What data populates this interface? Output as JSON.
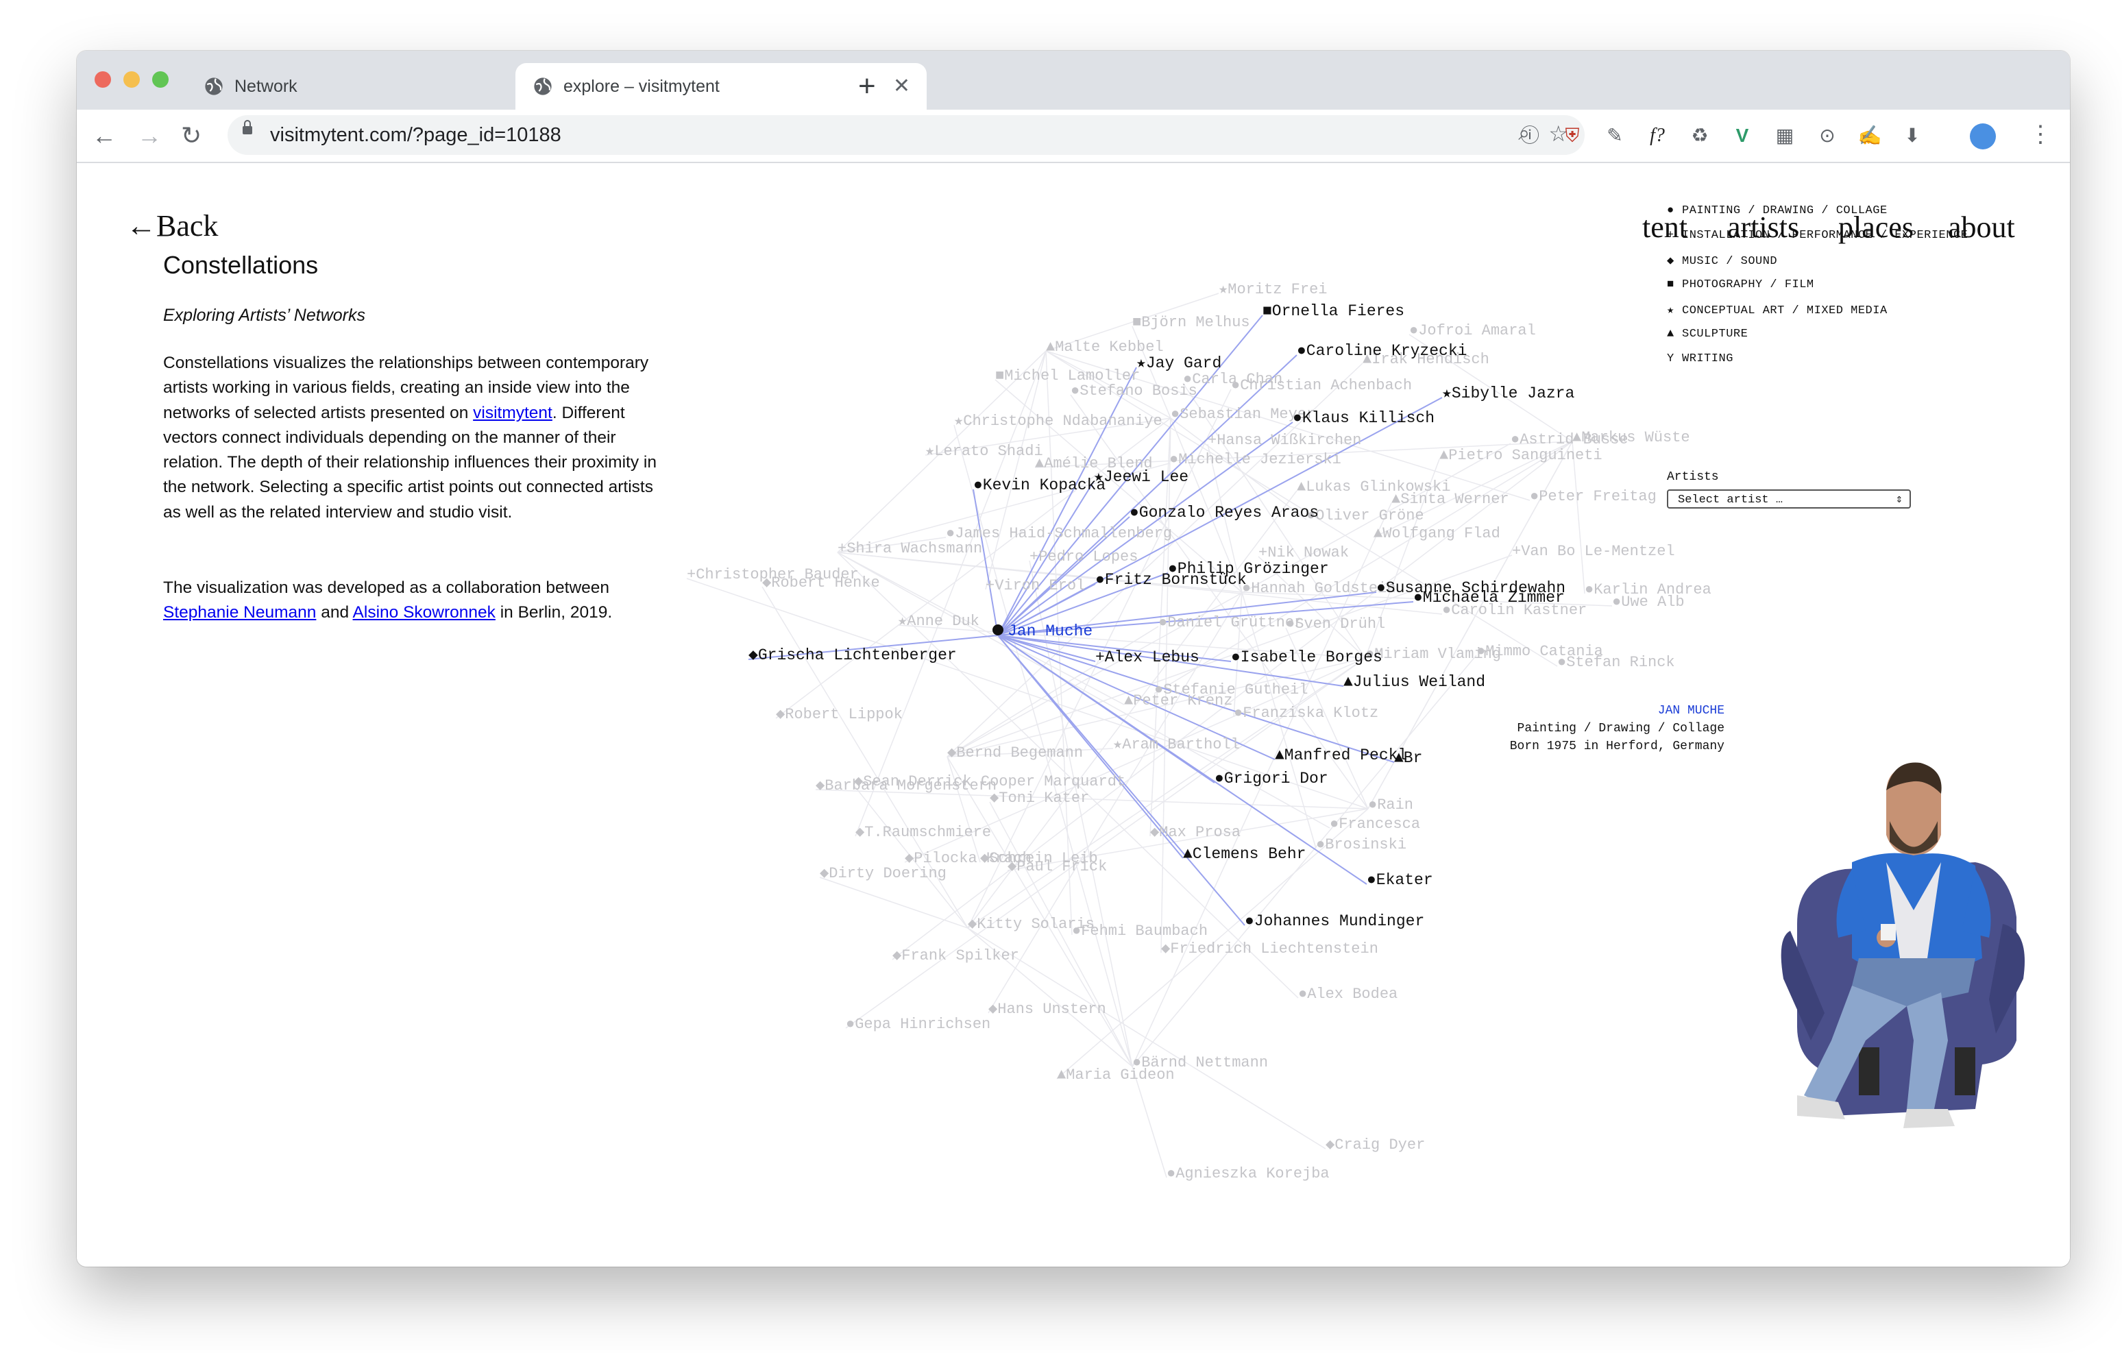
{
  "browser": {
    "tabs": [
      {
        "title": "Network",
        "active": false
      },
      {
        "title": "explore – visitmytent",
        "active": true
      }
    ],
    "url": "visitmytent.com/?page_id=10188"
  },
  "nav": {
    "back": "Back",
    "links": [
      "tent",
      "artists",
      "places",
      "about"
    ]
  },
  "intro": {
    "title": "Constellations",
    "subtitle": "Exploring Artists’ Networks",
    "p1_a": "Constellations visualizes the relationships between contemporary artists working in various fields, creating an inside view into the networks of selected artists presented on ",
    "p1_link": "visitmytent",
    "p1_b": ". Different vectors connect individuals depending on the manner of their relation. The depth of their relationship influences their proximity in the network. Selecting a specific artist points out connected artists as well as the related interview and studio visit.",
    "p2_a": "The visualization was developed as a collaboration between ",
    "p2_link1": "Stephanie Neumann",
    "p2_and": " and ",
    "p2_link2": "Alsino Skowronnek",
    "p2_b": " in Berlin, 2019."
  },
  "legend": [
    {
      "symbol": "dot",
      "label": "PAINTING / DRAWING / COLLAGE"
    },
    {
      "symbol": "cross",
      "label": "INSTALLATION / PERFORMANCE / EXPERIENCE"
    },
    {
      "symbol": "diamond",
      "label": "MUSIC / SOUND"
    },
    {
      "symbol": "square",
      "label": "PHOTOGRAPHY / FILM"
    },
    {
      "symbol": "star",
      "label": "CONCEPTUAL ART / MIXED MEDIA"
    },
    {
      "symbol": "triangle",
      "label": "SCULPTURE"
    },
    {
      "symbol": "y",
      "label": "WRITING"
    }
  ],
  "artist_select": {
    "label": "Artists",
    "value": "Select artist …"
  },
  "selected_artist": {
    "name": "JAN MUCHE",
    "fields": "Painting / Drawing / Collage",
    "born": "Born 1975 in Herford, Germany"
  },
  "network": {
    "center": {
      "name": "Jan Muche",
      "symbol": "dot"
    },
    "connected": [
      {
        "name": "Ornella Fieres",
        "symbol": "square"
      },
      {
        "name": "Caroline Kryzecki",
        "symbol": "dot"
      },
      {
        "name": "Jay Gard",
        "symbol": "star"
      },
      {
        "name": "Sibylle Jazra",
        "symbol": "star"
      },
      {
        "name": "Klaus Killisch",
        "symbol": "dot"
      },
      {
        "name": "Kevin Kopacka",
        "symbol": "dot"
      },
      {
        "name": "Jeewi Lee",
        "symbol": "star"
      },
      {
        "name": "Gonzalo Reyes Araos",
        "symbol": "dot"
      },
      {
        "name": "Philip Grözinger",
        "symbol": "dot"
      },
      {
        "name": "Fritz Bornstück",
        "symbol": "dot"
      },
      {
        "name": "Susanne Schirdewahn",
        "symbol": "dot"
      },
      {
        "name": "Michaela Zimmer",
        "symbol": "dot"
      },
      {
        "name": "Grischa Lichtenberger",
        "symbol": "diamond"
      },
      {
        "name": "Alex Lebus",
        "symbol": "cross"
      },
      {
        "name": "Isabelle Borges",
        "symbol": "dot"
      },
      {
        "name": "Julius Weiland",
        "symbol": "triangle"
      },
      {
        "name": "Manfred Peckl",
        "symbol": "triangle"
      },
      {
        "name": "Br",
        "symbol": "triangle"
      },
      {
        "name": "Grigori Dor",
        "symbol": "dot"
      },
      {
        "name": "Clemens Behr",
        "symbol": "triangle"
      },
      {
        "name": "Ekater",
        "symbol": "dot"
      },
      {
        "name": "Johannes Mundinger",
        "symbol": "dot"
      }
    ],
    "faded": [
      {
        "name": "Moritz Frei",
        "symbol": "star"
      },
      {
        "name": "Björn Melhus",
        "symbol": "square"
      },
      {
        "name": "Jofroi Amaral",
        "symbol": "dot"
      },
      {
        "name": "Malte Kebbel",
        "symbol": "triangle"
      },
      {
        "name": "Michel Lamoller",
        "symbol": "square"
      },
      {
        "name": "Carla Chan",
        "symbol": "dot"
      },
      {
        "name": "Irak Hendisch",
        "symbol": "triangle"
      },
      {
        "name": "Stefano Bosis",
        "symbol": "dot"
      },
      {
        "name": "Christian Achenbach",
        "symbol": "dot"
      },
      {
        "name": "Christophe Ndabananiye",
        "symbol": "star"
      },
      {
        "name": "Sebastian Meyer",
        "symbol": "dot"
      },
      {
        "name": "Lerato Shadi",
        "symbol": "star"
      },
      {
        "name": "Amélie Blend",
        "symbol": "triangle"
      },
      {
        "name": "Michelle Jezierski",
        "symbol": "dot"
      },
      {
        "name": "Hansa Wißkirchen",
        "symbol": "cross"
      },
      {
        "name": "Pietro Sanguineti",
        "symbol": "triangle"
      },
      {
        "name": "Astrid Busse",
        "symbol": "dot"
      },
      {
        "name": "Markus Wüste",
        "symbol": "triangle"
      },
      {
        "name": "Lukas Glinkowski",
        "symbol": "triangle"
      },
      {
        "name": "Sinta Werner",
        "symbol": "triangle"
      },
      {
        "name": "Peter Freitag",
        "symbol": "dot"
      },
      {
        "name": "Oliver Gröne",
        "symbol": "dot"
      },
      {
        "name": "Wolfgang Flad",
        "symbol": "triangle"
      },
      {
        "name": "James Haid-Schmallenberg",
        "symbol": "dot"
      },
      {
        "name": "Shira Wachsmann",
        "symbol": "cross"
      },
      {
        "name": "Nik Nowak",
        "symbol": "cross"
      },
      {
        "name": "Van Bo Le-Mentzel",
        "symbol": "cross"
      },
      {
        "name": "Christopher Bauder",
        "symbol": "cross"
      },
      {
        "name": "Robert Henke",
        "symbol": "diamond"
      },
      {
        "name": "Pedro Lopes",
        "symbol": "cross"
      },
      {
        "name": "Viron Erol",
        "symbol": "cross"
      },
      {
        "name": "Hannah Goldstein",
        "symbol": "dot"
      },
      {
        "name": "Karlin Andrea",
        "symbol": "dot"
      },
      {
        "name": "Carolin Kastner",
        "symbol": "dot"
      },
      {
        "name": "Uwe Alb",
        "symbol": "dot"
      },
      {
        "name": "Anne Duk",
        "symbol": "star"
      },
      {
        "name": "Daniel Grüttner",
        "symbol": "dot"
      },
      {
        "name": "Sven Drühl",
        "symbol": "dot"
      },
      {
        "name": "Miriam Vlaming",
        "symbol": "dot"
      },
      {
        "name": "Mimmo Catania",
        "symbol": "dot"
      },
      {
        "name": "Stefan Rinck",
        "symbol": "dot"
      },
      {
        "name": "Robert Lippok",
        "symbol": "diamond"
      },
      {
        "name": "Stefanie Gutheil",
        "symbol": "dot"
      },
      {
        "name": "Peter Krenz",
        "symbol": "triangle"
      },
      {
        "name": "Franziska Klotz",
        "symbol": "dot"
      },
      {
        "name": "Bernd Begemann",
        "symbol": "diamond"
      },
      {
        "name": "Aram Bartholl",
        "symbol": "star"
      },
      {
        "name": "Barbara Morgenstern",
        "symbol": "diamond"
      },
      {
        "name": "Sean Derrick Cooper Marquardt",
        "symbol": "diamond"
      },
      {
        "name": "Toni Kater",
        "symbol": "diamond"
      },
      {
        "name": "T.Raumschmiere",
        "symbol": "diamond"
      },
      {
        "name": "Max Prosa",
        "symbol": "diamond"
      },
      {
        "name": "Rain",
        "symbol": "dot"
      },
      {
        "name": "Francesca",
        "symbol": "dot"
      },
      {
        "name": "Brosinski",
        "symbol": "dot"
      },
      {
        "name": "Pilocka Krach",
        "symbol": "diamond"
      },
      {
        "name": "Schrein Leib",
        "symbol": "diamond"
      },
      {
        "name": "Paul Frick",
        "symbol": "diamond"
      },
      {
        "name": "Dirty Doering",
        "symbol": "diamond"
      },
      {
        "name": "Kitty Solaris",
        "symbol": "diamond"
      },
      {
        "name": "Fehmi Baumbach",
        "symbol": "dot"
      },
      {
        "name": "Friedrich Liechtenstein",
        "symbol": "diamond"
      },
      {
        "name": "Frank Spilker",
        "symbol": "diamond"
      },
      {
        "name": "Alex Bodea",
        "symbol": "dot"
      },
      {
        "name": "Hans Unstern",
        "symbol": "diamond"
      },
      {
        "name": "Gepa Hinrichsen",
        "symbol": "dot"
      },
      {
        "name": "Bärnd Nettmann",
        "symbol": "dot"
      },
      {
        "name": "Maria Gideon",
        "symbol": "triangle"
      },
      {
        "name": "Craig Dyer",
        "symbol": "diamond"
      },
      {
        "name": "Agnieszka Korejba",
        "symbol": "dot"
      }
    ]
  }
}
